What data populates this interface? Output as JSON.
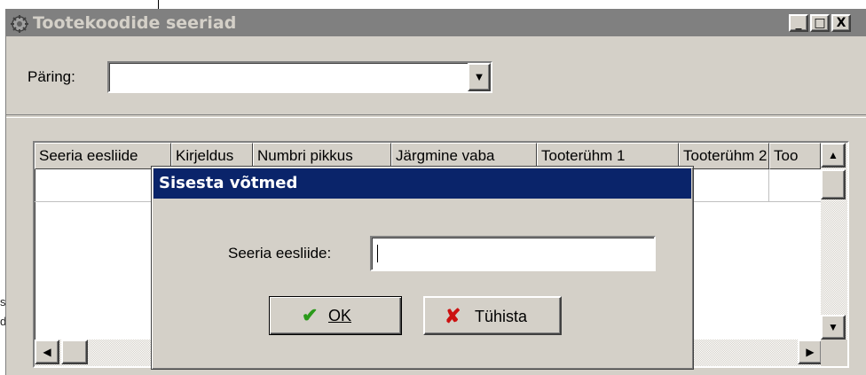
{
  "background": {
    "glyphs": [
      "s",
      "d"
    ]
  },
  "window": {
    "title": "Tootekoodide seeriad",
    "buttons": {
      "minimize": "_",
      "maximize": "□",
      "close": "X"
    }
  },
  "query": {
    "label": "Päring:",
    "value": ""
  },
  "grid": {
    "columns": [
      "Seeria eesliide",
      "Kirjeldus",
      "Numbri pikkus",
      "Järgmine vaba",
      "Tooterühm 1",
      "Tooterühm 2",
      "Too"
    ]
  },
  "dialog": {
    "title": "Sisesta võtmed",
    "field_label": "Seeria eesliide:",
    "field_value": "",
    "ok_label": "OK",
    "cancel_label": "Tühista"
  },
  "colors": {
    "title_inactive": "#808080",
    "title_active": "#0a246a",
    "face": "#d4d0c8",
    "ok_check": "#2a9a1a",
    "cancel_x": "#cc1010"
  }
}
